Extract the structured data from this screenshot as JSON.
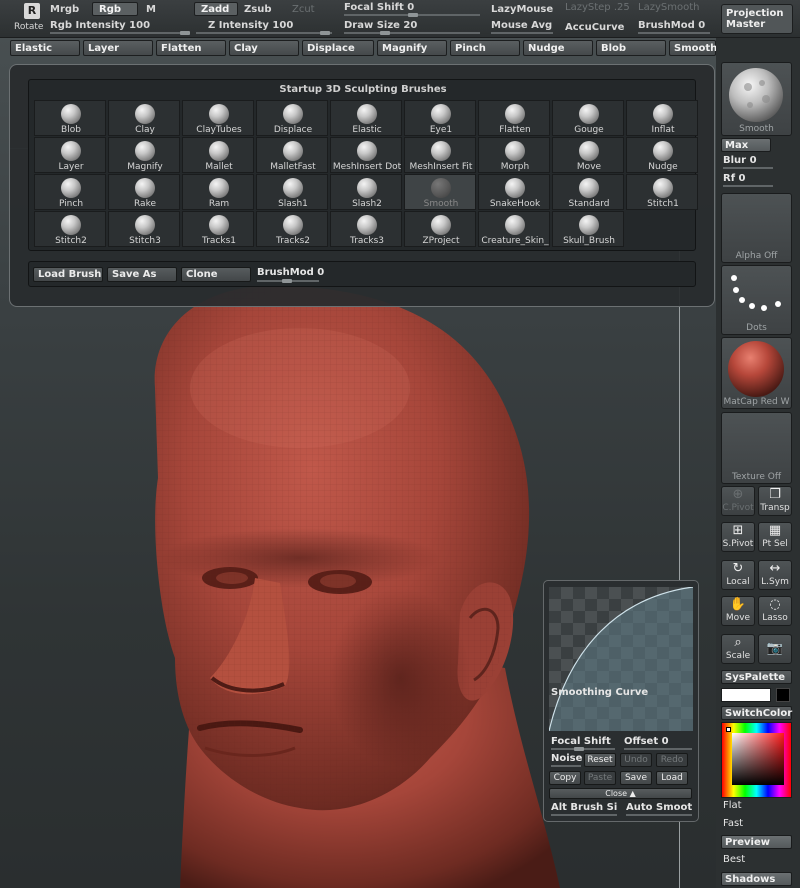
{
  "toolbar": {
    "rotate_label": "Rotate",
    "mrgb": "Mrgb",
    "rgb": "Rgb",
    "m": "M",
    "rgb_intensity": "Rgb Intensity 100",
    "zadd": "Zadd",
    "zsub": "Zsub",
    "zcut": "Zcut",
    "z_intensity": "Z Intensity 100",
    "focal_shift": "Focal Shift 0",
    "draw_size": "Draw Size 20",
    "lazymouse": "LazyMouse",
    "lazystep": "LazyStep .25",
    "lazysmooth": "LazySmooth",
    "mouse_avg": "Mouse Avg",
    "accucurve": "AccuCurve",
    "brushmod": "BrushMod 0",
    "projection_master": [
      "Projection",
      "Master"
    ]
  },
  "brush_row": [
    "Elastic",
    "Layer",
    "Flatten",
    "Clay",
    "Displace",
    "Magnify",
    "Pinch",
    "Nudge",
    "Blob",
    "Smooth"
  ],
  "brush_palette": {
    "title": "Startup 3D Sculpting Brushes",
    "selected": "Smooth",
    "brushes": [
      "Blob",
      "Clay",
      "ClayTubes",
      "Displace",
      "Elastic",
      "Eye1",
      "Flatten",
      "Gouge",
      "Inflat",
      "Layer",
      "Magnify",
      "Mallet",
      "MalletFast",
      "MeshInsert Dot",
      "MeshInsert Fit",
      "Morph",
      "Move",
      "Nudge",
      "Pinch",
      "Rake",
      "Ram",
      "Slash1",
      "Slash2",
      "Smooth",
      "SnakeHook",
      "Standard",
      "Stitch1",
      "Stitch2",
      "Stitch3",
      "Tracks1",
      "Tracks2",
      "Tracks3",
      "ZProject",
      "Creature_Skin_",
      "Skull_Brush"
    ],
    "load_brush": "Load Brush",
    "save_as": "Save As",
    "clone": "Clone",
    "brushmod": "BrushMod 0"
  },
  "right_shelf": {
    "brush_tile": "Smooth",
    "max": "Max",
    "blur": "Blur 0",
    "rf": "Rf 0",
    "alpha_tile": "Alpha  Off",
    "stroke_tile": "Dots",
    "material_tile": "MatCap Red W",
    "texture_tile": "Texture  Off",
    "cpivot": "C.Pivot",
    "transp": "Transp",
    "spivot": "S.Pivot",
    "ptsel": "Pt Sel",
    "local": "Local",
    "lsym": "L.Sym",
    "move": "Move",
    "lasso": "Lasso",
    "scale": "Scale",
    "syspalette": "SysPalette",
    "switchcolor": "SwitchColor",
    "flat": "Flat",
    "fast": "Fast",
    "preview": "Preview",
    "best": "Best",
    "shadows": "Shadows"
  },
  "curve_panel": {
    "title": "Smoothing Curve",
    "focal_shift": "Focal Shift",
    "offset": "Offset 0",
    "noise": "Noise",
    "reset": "Reset",
    "undo": "Undo",
    "redo": "Redo",
    "copy": "Copy",
    "paste": "Paste",
    "save": "Save",
    "load": "Load",
    "close": "Close ▲",
    "alt_brush": "Alt Brush Si",
    "auto_smooth": "Auto Smoot"
  },
  "colors": {
    "skin": "#a6463a",
    "primary_color": "#ffffff",
    "secondary_color": "#000000"
  }
}
